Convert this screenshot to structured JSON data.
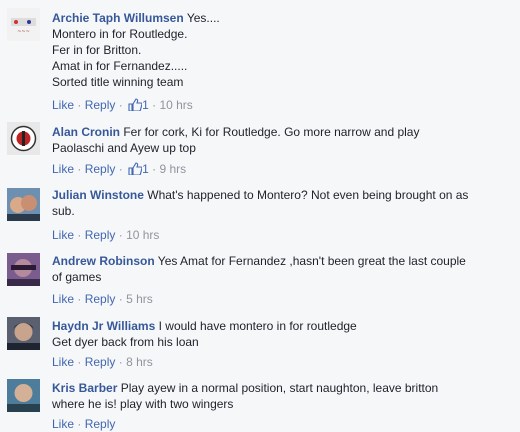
{
  "comments": [
    {
      "author": "Archie Taph Willumsen",
      "lines": [
        "Yes....",
        "Montero in for Routledge.",
        "Fer in for Britton.",
        "Amat in for Fernandez.....",
        "Sorted title winning team"
      ],
      "like_label": "Like",
      "reply_label": "Reply",
      "likes": "1",
      "time": "10 hrs",
      "avatar_icon": "avatar-photo-icon"
    },
    {
      "author": "Alan Cronin",
      "lines": [
        "Fer for cork, Ki for Routledge. Go more narrow and play",
        "Paolaschi and Ayew up top"
      ],
      "like_label": "Like",
      "reply_label": "Reply",
      "likes": "1",
      "time": "9 hrs",
      "avatar_icon": "avatar-badge-icon"
    },
    {
      "author": "Julian Winstone",
      "lines": [
        "What's happened to Montero? Not even being brought on as",
        "sub."
      ],
      "like_label": "Like",
      "reply_label": "Reply",
      "likes": "",
      "time": "10 hrs",
      "avatar_icon": "avatar-photo-icon"
    },
    {
      "author": "Andrew Robinson",
      "lines": [
        "Yes Amat for Fernandez ,hasn't been great the last couple",
        "of games"
      ],
      "like_label": "Like",
      "reply_label": "Reply",
      "likes": "",
      "time": "5 hrs",
      "avatar_icon": "avatar-photo-icon"
    },
    {
      "author": "Haydn Jr Williams",
      "lines": [
        "I would have montero in for routledge",
        "Get dyer back from his loan"
      ],
      "like_label": "Like",
      "reply_label": "Reply",
      "likes": "",
      "time": "8 hrs",
      "avatar_icon": "avatar-photo-icon"
    },
    {
      "author": "Kris Barber",
      "lines": [
        "Play ayew in a normal position, start naughton, leave britton",
        "where he is! play with two wingers"
      ],
      "like_label": "Like",
      "reply_label": "Reply",
      "likes": "",
      "time": "",
      "avatar_icon": "avatar-photo-icon"
    }
  ],
  "separator": "·",
  "colors": {
    "name": "#365899",
    "link": "#4267b2",
    "meta": "#90949c",
    "text": "#1d2129",
    "background": "#f6f7f9"
  }
}
